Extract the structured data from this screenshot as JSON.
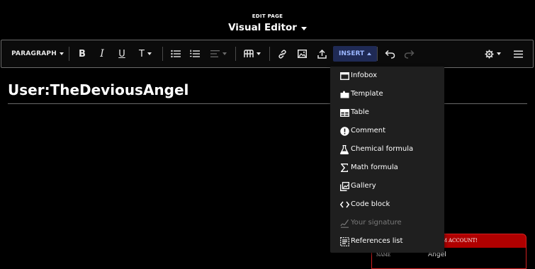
{
  "header": {
    "edit_label": "EDIT PAGE",
    "editor_mode": "Visual Editor"
  },
  "toolbar": {
    "paragraph_label": "PARAGRAPH",
    "bold": "B",
    "italic": "I",
    "underline": "U",
    "more_text_styles": "T",
    "insert_label": "INSERT"
  },
  "page": {
    "title": "User:TheDeviousAngel"
  },
  "infobox_preview": {
    "header_text": "Y FANDOM ACCOUNT!",
    "field_name": "NAME",
    "field_value": "Angel"
  },
  "insert_menu": {
    "items": [
      {
        "label": "Infobox",
        "icon": "infobox-icon",
        "enabled": true
      },
      {
        "label": "Template",
        "icon": "puzzle-icon",
        "enabled": true
      },
      {
        "label": "Table",
        "icon": "table-icon",
        "enabled": true
      },
      {
        "label": "Comment",
        "icon": "comment-alert-icon",
        "enabled": true
      },
      {
        "label": "Chemical formula",
        "icon": "flask-icon",
        "enabled": true
      },
      {
        "label": "Math formula",
        "icon": "sigma-icon",
        "enabled": true
      },
      {
        "label": "Gallery",
        "icon": "gallery-icon",
        "enabled": true
      },
      {
        "label": "Code block",
        "icon": "code-icon",
        "enabled": true
      },
      {
        "label": "Your signature",
        "icon": "signature-icon",
        "enabled": false
      },
      {
        "label": "References list",
        "icon": "references-icon",
        "enabled": true
      }
    ]
  },
  "colors": {
    "insert_accent": "#9bb6ff",
    "insert_bg": "#1f2a55",
    "infobox_red": "#b00000"
  }
}
